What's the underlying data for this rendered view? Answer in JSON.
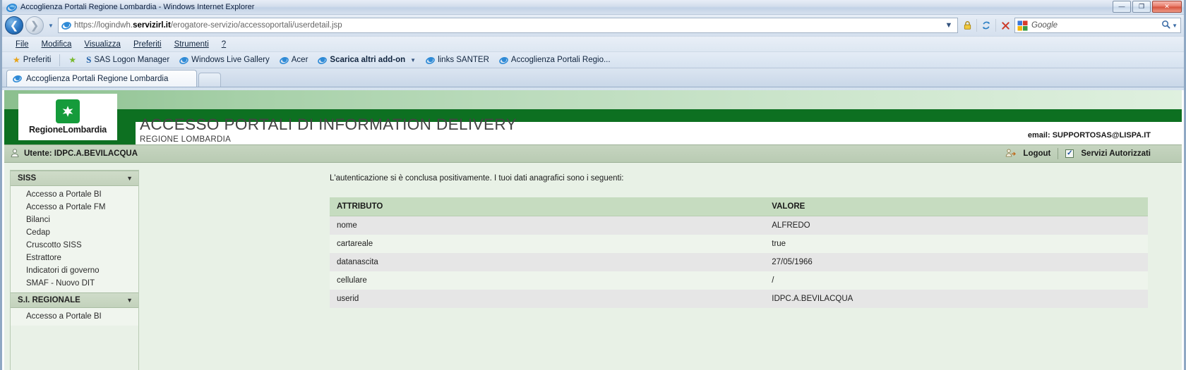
{
  "window": {
    "title": "Accoglienza Portali Regione Lombardia - Windows Internet Explorer",
    "minimize_label": "—",
    "maximize_label": "❐",
    "close_label": "✕"
  },
  "navigation": {
    "back_icon": "back-arrow-icon",
    "forward_icon": "forward-arrow-icon",
    "history_icon": "chevron-down-icon",
    "url_protocol": "https://logindwh.",
    "url_domain": "servizirl.it",
    "url_path": "/erogatore-servizio/accessoportali/userdetail.jsp",
    "dropdown_icon": "chevron-down-icon",
    "lock_icon": "padlock-icon",
    "refresh_icon": "refresh-icon",
    "stop_icon": "stop-icon",
    "search_engine": "Google",
    "search_value": "",
    "search_icon": "magnifier-icon"
  },
  "menubar": {
    "items": [
      {
        "label": "File"
      },
      {
        "label": "Modifica"
      },
      {
        "label": "Visualizza"
      },
      {
        "label": "Preferiti"
      },
      {
        "label": "Strumenti"
      },
      {
        "label": "?"
      }
    ]
  },
  "favbar": {
    "favorites_label": "Preferiti",
    "items": [
      {
        "label": "SAS Logon Manager",
        "icon": "sas-icon",
        "bold": false
      },
      {
        "label": "Windows Live Gallery",
        "icon": "page-icon",
        "bold": false
      },
      {
        "label": "Acer",
        "icon": "page-icon",
        "bold": false
      },
      {
        "label": "Scarica altri add-on",
        "icon": "page-icon",
        "bold": true,
        "has_caret": true
      },
      {
        "label": "links SANTER",
        "icon": "page-icon",
        "bold": false
      },
      {
        "label": "Accoglienza Portali Regio...",
        "icon": "page-icon",
        "bold": false
      }
    ]
  },
  "tabs": {
    "items": [
      {
        "label": "Accoglienza Portali Regione Lombardia",
        "icon": "page-icon",
        "active": true
      }
    ],
    "new_tab_label": ""
  },
  "banner": {
    "logo_text": "RegioneLombardia",
    "logo_mark": "lombardia-flower-icon",
    "title": "ACCESSO PORTALI DI INFORMATION DELIVERY",
    "subtitle": "REGIONE LOMBARDIA",
    "email": "email: SUPPORTOSAS@LISPA.IT"
  },
  "userbar": {
    "user_icon": "user-icon",
    "user_label": "Utente: IDPC.A.BEVILACQUA",
    "logout_icon": "logout-icon",
    "logout_label": "Logout",
    "services_checkbox": "✓",
    "services_label": "Servizi Autorizzati"
  },
  "sidebar": {
    "groups": [
      {
        "title": "SISS",
        "arrow_icon": "chevron-down-icon",
        "items": [
          {
            "label": "Accesso a Portale BI"
          },
          {
            "label": "Accesso a Portale FM"
          },
          {
            "label": "Bilanci"
          },
          {
            "label": "Cedap"
          },
          {
            "label": "Cruscotto SISS"
          },
          {
            "label": "Estrattore"
          },
          {
            "label": "Indicatori di governo"
          },
          {
            "label": "SMAF - Nuovo DIT"
          }
        ]
      },
      {
        "title": "S.I. REGIONALE",
        "arrow_icon": "chevron-down-icon",
        "items": [
          {
            "label": "Accesso a Portale BI"
          }
        ]
      }
    ]
  },
  "content": {
    "intro": "L'autenticazione si è conclusa positivamente. I tuoi dati anagrafici sono i seguenti:",
    "table": {
      "headers": [
        "ATTRIBUTO",
        "VALORE"
      ],
      "rows": [
        {
          "attributo": "nome",
          "valore": "ALFREDO"
        },
        {
          "attributo": "cartareale",
          "valore": "true"
        },
        {
          "attributo": "datanascita",
          "valore": "27/05/1966"
        },
        {
          "attributo": "cellulare",
          "valore": "/"
        },
        {
          "attributo": "userid",
          "valore": "IDPC.A.BEVILACQUA"
        }
      ]
    }
  },
  "colors": {
    "brand_green": "#0d7021",
    "logo_green": "#159b3b",
    "table_header": "#c6dcc0",
    "page_bg": "#e8f1e6"
  }
}
